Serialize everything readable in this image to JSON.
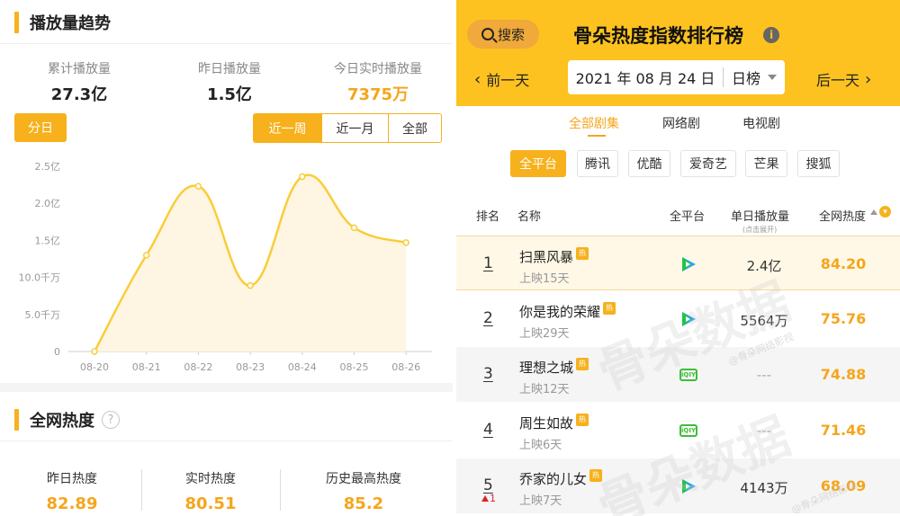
{
  "left": {
    "trend": {
      "title": "播放量趋势",
      "stats": [
        {
          "label": "累计播放量",
          "value": "27.3亿"
        },
        {
          "label": "昨日播放量",
          "value": "1.5亿"
        },
        {
          "label": "今日实时播放量",
          "value": "7375万"
        }
      ],
      "day_button": "分日",
      "ranges": [
        "近一周",
        "近一月",
        "全部"
      ],
      "active_range": "近一周"
    },
    "heat": {
      "title": "全网热度",
      "help_icon": "question-circle-icon",
      "stats": [
        {
          "label": "昨日热度",
          "value": "82.89"
        },
        {
          "label": "实时热度",
          "value": "80.51"
        },
        {
          "label": "历史最高热度",
          "value": "85.2"
        }
      ]
    }
  },
  "chart_data": {
    "type": "area",
    "categories": [
      "08-20",
      "08-21",
      "08-22",
      "08-23",
      "08-24",
      "08-25",
      "08-26"
    ],
    "values": [
      0,
      1.3,
      2.23,
      0.89,
      2.36,
      1.67,
      1.47
    ],
    "unit": "亿",
    "ylim": [
      0,
      2.5
    ],
    "y_ticks": [
      {
        "value": 0,
        "label": "0"
      },
      {
        "value": 0.5,
        "label": "5.0千万"
      },
      {
        "value": 1.0,
        "label": "10.0千万"
      },
      {
        "value": 1.5,
        "label": "1.5亿"
      },
      {
        "value": 2.0,
        "label": "2.0亿"
      },
      {
        "value": 2.5,
        "label": "2.5亿"
      }
    ],
    "grid": false,
    "line_color": "#f9cd3a",
    "fill_color": "#fef6e2"
  },
  "right": {
    "search_label": "搜索",
    "title": "骨朵热度指数排行榜",
    "prev_day": "前一天",
    "next_day": "后一天",
    "date": "2021 年 08 月 24 日",
    "period": "日榜",
    "tabs": [
      "全部剧集",
      "网络剧",
      "电视剧"
    ],
    "active_tab": "全部剧集",
    "platforms": [
      "全平台",
      "腾讯",
      "优酷",
      "爱奇艺",
      "芒果",
      "搜狐"
    ],
    "active_platform": "全平台",
    "columns": {
      "rank": "排名",
      "name": "名称",
      "platform": "全平台",
      "views": "单日播放量",
      "views_hint": "(点击展开)",
      "heat": "全网热度"
    },
    "hot_badge": "热",
    "rows": [
      {
        "rank": "1",
        "name": "扫黑风暴",
        "days": "上映15天",
        "platform": "tencent",
        "views": "2.4亿",
        "heat": "84.20",
        "change": ""
      },
      {
        "rank": "2",
        "name": "你是我的荣耀",
        "days": "上映29天",
        "platform": "tencent",
        "views": "5564万",
        "heat": "75.76",
        "change": ""
      },
      {
        "rank": "3",
        "name": "理想之城",
        "days": "上映12天",
        "platform": "iqiyi",
        "views": "---",
        "heat": "74.88",
        "change": ""
      },
      {
        "rank": "4",
        "name": "周生如故",
        "days": "上映6天",
        "platform": "iqiyi",
        "views": "---",
        "heat": "71.46",
        "change": ""
      },
      {
        "rank": "5",
        "name": "乔家的儿女",
        "days": "上映7天",
        "platform": "tencent",
        "views": "4143万",
        "heat": "68.09",
        "change": "1"
      }
    ],
    "watermark": "骨朵数据",
    "watermark_small": "@骨朵网络影视"
  },
  "colors": {
    "accent": "#f6b11c",
    "header_yellow": "#fdc21f",
    "value_orange": "#f6a51c"
  }
}
